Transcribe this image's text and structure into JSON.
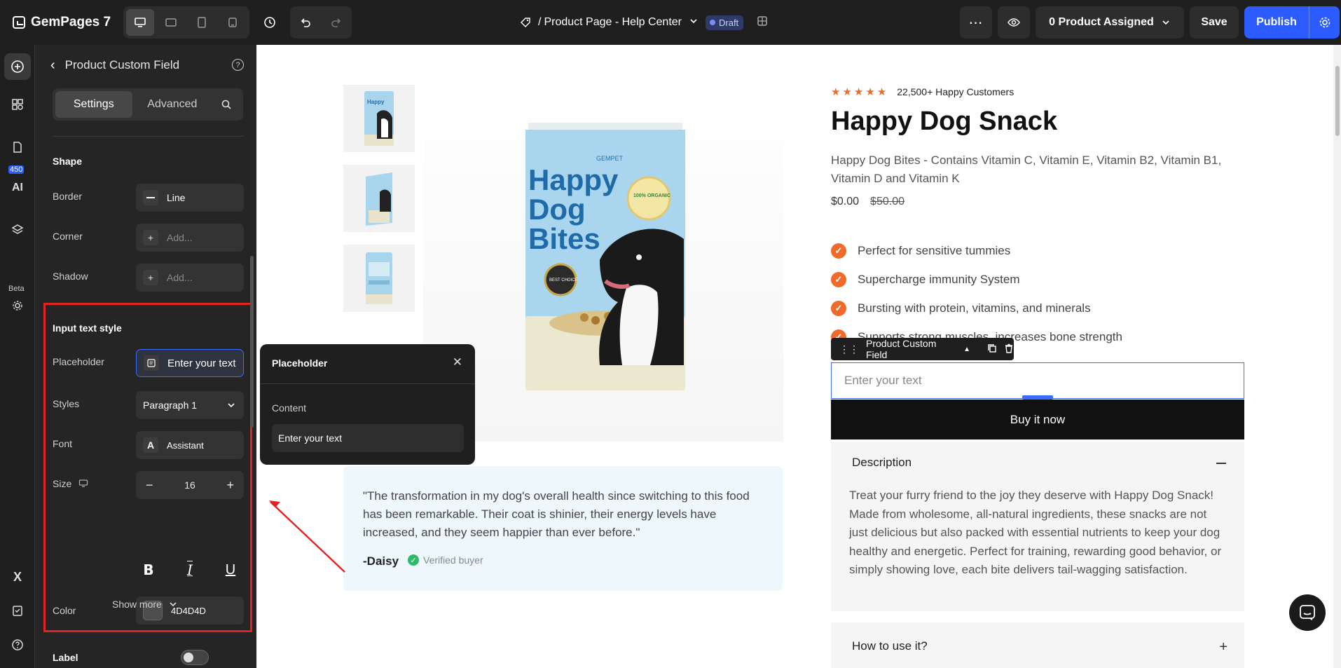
{
  "app": {
    "name": "GemPages 7"
  },
  "header": {
    "page_path_prefix": "/",
    "page_title": "Product Page - Help Center",
    "status": "Draft",
    "assigned": "0 Product Assigned",
    "save_label": "Save",
    "publish_label": "Publish"
  },
  "rail": {
    "badge": "450",
    "beta": "Beta"
  },
  "panel": {
    "title": "Product Custom Field",
    "tabs": [
      "Settings",
      "Advanced"
    ],
    "shape": {
      "title": "Shape",
      "border_label": "Border",
      "border_value": "Line",
      "corner_label": "Corner",
      "corner_value": "Add...",
      "shadow_label": "Shadow",
      "shadow_value": "Add..."
    },
    "input_style": {
      "title": "Input text style",
      "placeholder_label": "Placeholder",
      "placeholder_value": "Enter your text",
      "styles_label": "Styles",
      "styles_value": "Paragraph 1",
      "font_label": "Font",
      "font_value": "Assistant",
      "size_label": "Size",
      "size_value": "16",
      "color_label": "Color",
      "color_value": "4D4D4D",
      "show_more": "Show more"
    },
    "label_row": "Label"
  },
  "popover": {
    "title": "Placeholder",
    "content_label": "Content",
    "content_value": "Enter your text"
  },
  "product": {
    "rating_text": "22,500+ Happy Customers",
    "title": "Happy Dog Snack",
    "description": "Happy Dog Bites - Contains Vitamin C, Vitamin E, Vitamin B2, Vitamin B1, Vitamin D and Vitamin K",
    "price": "$0.00",
    "compare_price": "$50.00",
    "benefits": [
      "Perfect for sensitive tummies",
      "Supercharge immunity System",
      "Bursting with protein, vitamins, and minerals",
      "Supports strong muscles, increases bone strength"
    ],
    "custom_field_tag": "Product Custom Field",
    "custom_field_placeholder": "Enter your text",
    "buy_label": "Buy it now",
    "accordion": [
      {
        "title": "Description",
        "body": "Treat your furry friend to the joy they deserve with Happy Dog Snack! Made from wholesome, all-natural ingredients, these snacks are not just delicious but also packed with essential nutrients to keep your dog healthy and energetic. Perfect for training, rewarding good behavior, or simply showing love, each bite delivers tail-wagging satisfaction."
      },
      {
        "title": "How to use it?"
      }
    ],
    "bag_text": "Happy Dog Bites",
    "bag_brand": "GEMPET",
    "bag_seal": "BEST CHOICE",
    "bag_organic": "100% ORGANIC"
  },
  "review": {
    "quote": "\"The transformation in my dog's overall health since switching to this food has been remarkable. Their coat is shinier, their energy levels have increased, and they seem happier than ever before.\"",
    "author": "-Daisy",
    "verified": "Verified buyer"
  },
  "colors": {
    "accent": "#2c5cff",
    "highlight": "#e32222",
    "brand_orange": "#f06a2b",
    "text_color": "#4D4D4D"
  }
}
